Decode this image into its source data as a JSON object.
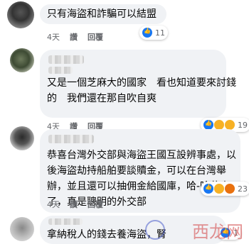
{
  "comments": [
    {
      "text_lines": [
        "只有海盜和詐騙可以結盟"
      ],
      "time": "4天",
      "like_label": "讚",
      "reply_label": "回覆",
      "reactions": [
        "like"
      ],
      "reaction_count": "11"
    },
    {
      "text_lines": [
        "又是一個芝麻大的國家　看也知道要來討錢",
        "的　我們還在那自吹自爽"
      ],
      "time": "4天",
      "like_label": "讚",
      "reply_label": "回覆",
      "reactions": [
        "like",
        "haha",
        "sad"
      ],
      "reaction_count": "19"
    },
    {
      "text_lines": [
        "恭喜台灣外交部與海盜王國互設辨事處，以",
        "後海盜劫持船舶要談贖金，可以在台灣舉",
        "辦，並且還可以抽佣金給國庫，哈-哈恭喜",
        "了，真是聰明的外交部"
      ],
      "time": "4天",
      "like_label": "讚",
      "reply_label": "回覆",
      "reactions": [
        "like",
        "haha",
        "angry"
      ],
      "reaction_count": "23"
    },
    {
      "text_lines": [
        "拿納稅人的錢去養海盜，腎"
      ],
      "time": "",
      "like_label": "",
      "reply_label": "",
      "reactions": [
        "like"
      ],
      "reaction_count": "1"
    }
  ],
  "watermark": "西龙网"
}
